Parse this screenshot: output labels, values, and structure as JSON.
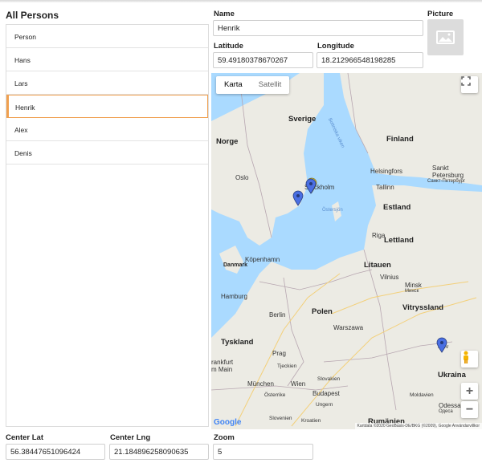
{
  "persons": {
    "title": "All Persons",
    "items": [
      "Person",
      "Hans",
      "Lars",
      "Henrik",
      "Alex",
      "Denis"
    ],
    "selected_index": 3
  },
  "form": {
    "name_label": "Name",
    "name_value": "Henrik",
    "picture_label": "Picture",
    "latitude_label": "Latitude",
    "latitude_value": "59.49180378670267",
    "longitude_label": "Longitude",
    "longitude_value": "18.212966548198285"
  },
  "map": {
    "type_map": "Karta",
    "type_satellite": "Satellit",
    "attribution": "Kartdata ©2020 GeoBasis-DE/BKG (©2009), Google   Användarvillkor",
    "google_label": "Google",
    "labels": {
      "sverige": "Sverige",
      "norge": "Norge",
      "finland": "Finland",
      "oslo": "Oslo",
      "stockholm": "Stockholm",
      "helsingfors": "Helsingfors",
      "sankt": "Sankt",
      "petersburg": "Petersburg",
      "sankt_ru": "Санкт-Петербург",
      "tallinn": "Tallinn",
      "estland": "Estland",
      "riga": "Riga",
      "lettland": "Lettland",
      "danmark": "Danmark",
      "kopenhamn": "Köpenhamn",
      "litauen": "Litauen",
      "vilnius": "Vilnius",
      "minsk": "Minsk",
      "minsk_ru": "Минск",
      "vitryssland": "Vitryssland",
      "hamburg": "Hamburg",
      "berlin": "Berlin",
      "polen": "Polen",
      "warszawa": "Warszawa",
      "tyskland": "Tyskland",
      "prag": "Prag",
      "tjeckien": "Tjeckien",
      "frankfurt": "rankfurt",
      "main": "m Main",
      "munchen": "München",
      "wien": "Wien",
      "slovakien": "Slovakien",
      "osterrike": "Österrike",
      "budapest": "Budapest",
      "ungern": "Ungern",
      "slovenien": "Slovenien",
      "kroatien": "Kroatien",
      "rumanien": "Rumänien",
      "ukraina": "Ukraina",
      "kyiv": "Kyiv",
      "moldavien": "Moldavien",
      "odessa": "Odessa",
      "odessa_ru": "Одеса",
      "bottenhavet": "Bottniska viken",
      "ostersjon": "Östersjön"
    }
  },
  "center": {
    "lat_label": "Center Lat",
    "lat_value": "56.38447651096424",
    "lng_label": "Center Lng",
    "lng_value": "21.184896258090635",
    "zoom_label": "Zoom",
    "zoom_value": "5"
  },
  "colors": {
    "selected_border": "#f0a050",
    "marker_blue": "#4a6fe3",
    "marker_yellow": "#f5e23a",
    "land": "#f0eee8",
    "water": "#aadaff"
  },
  "icons": {
    "picture": "image-placeholder-icon",
    "fullscreen": "fullscreen-icon",
    "pegman": "street-view-pegman-icon",
    "zoom_in": "plus-icon",
    "zoom_out": "minus-icon"
  }
}
